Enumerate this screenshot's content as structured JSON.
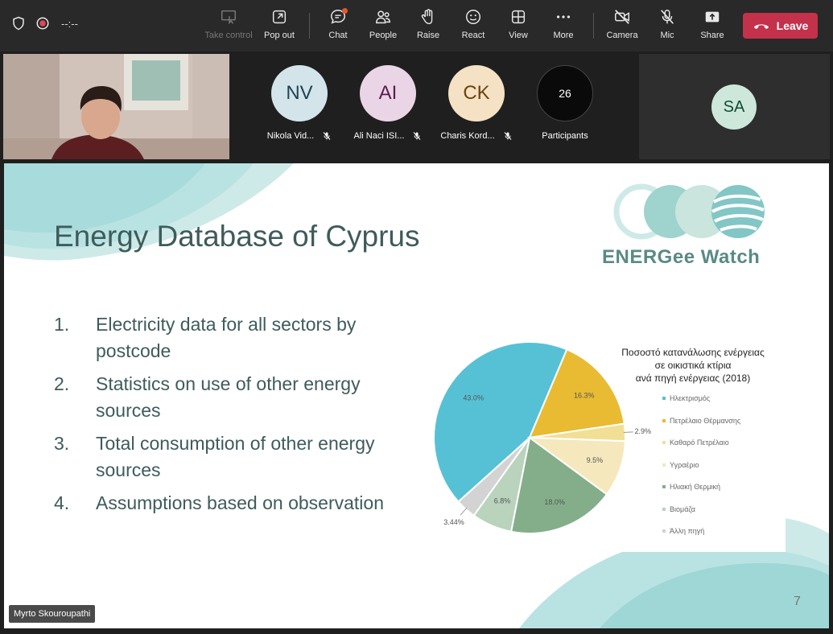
{
  "toolbar": {
    "timer": "--:--",
    "buttons": {
      "take_control": "Take control",
      "pop_out": "Pop out",
      "chat": "Chat",
      "people": "People",
      "raise": "Raise",
      "react": "React",
      "view": "View",
      "more": "More",
      "camera": "Camera",
      "mic": "Mic",
      "share": "Share"
    },
    "leave_label": "Leave"
  },
  "participants": [
    {
      "initials": "NV",
      "name": "Nikola Vid...",
      "bg": "#d3e4ea",
      "fg": "#204454"
    },
    {
      "initials": "AI",
      "name": "Ali Naci ISI...",
      "bg": "#ead5e6",
      "fg": "#5a1f4f"
    },
    {
      "initials": "CK",
      "name": "Charis Kord...",
      "bg": "#f5e1c4",
      "fg": "#6b4510"
    }
  ],
  "participants_count": {
    "count": "26",
    "label": "Participants"
  },
  "sa_tile": {
    "initials": "SA"
  },
  "slide": {
    "title": "Energy Database of Cyprus",
    "brand": "ENERGee Watch",
    "page_number": "7",
    "items": [
      {
        "num": "1.",
        "text": "Electricity data for all sectors by postcode"
      },
      {
        "num": "2.",
        "text": "Statistics on use of other energy sources"
      },
      {
        "num": "3.",
        "text": "Total consumption of other energy sources"
      },
      {
        "num": "4.",
        "text": "Assumptions based on observation"
      }
    ]
  },
  "chart_data": {
    "type": "pie",
    "title_lines": [
      "Ποσοστό κατανάλωσης ενέργειας",
      "σε οικιστικά κτίρια",
      "ανά πηγή ενέργειας (2018)"
    ],
    "slices": [
      {
        "label": "Ηλεκτρισμός",
        "value": 43.0,
        "display": "43.0%",
        "color": "#56c1d5"
      },
      {
        "label": "Πετρέλαιο Θέρμανσης",
        "value": 16.3,
        "display": "16.3%",
        "color": "#e8bb32"
      },
      {
        "label": "Καθαρό Πετρέλαιο",
        "value": 2.9,
        "display": "2.9%",
        "color": "#f2df96"
      },
      {
        "label": "Υγραέριο",
        "value": 9.5,
        "display": "9.5%",
        "color": "#f5e8bd"
      },
      {
        "label": "Ηλιακή Θερμική",
        "value": 18.0,
        "display": "18.0%",
        "color": "#84ae8a"
      },
      {
        "label": "Βιομάζα",
        "value": 6.8,
        "display": "6.8%",
        "color": "#b9d3bd"
      },
      {
        "label": "Άλλη πηγή",
        "value": 3.44,
        "display": "3.44%",
        "color": "#d3d3d3"
      }
    ]
  },
  "presenter_name": "Myrto Skouroupathi"
}
